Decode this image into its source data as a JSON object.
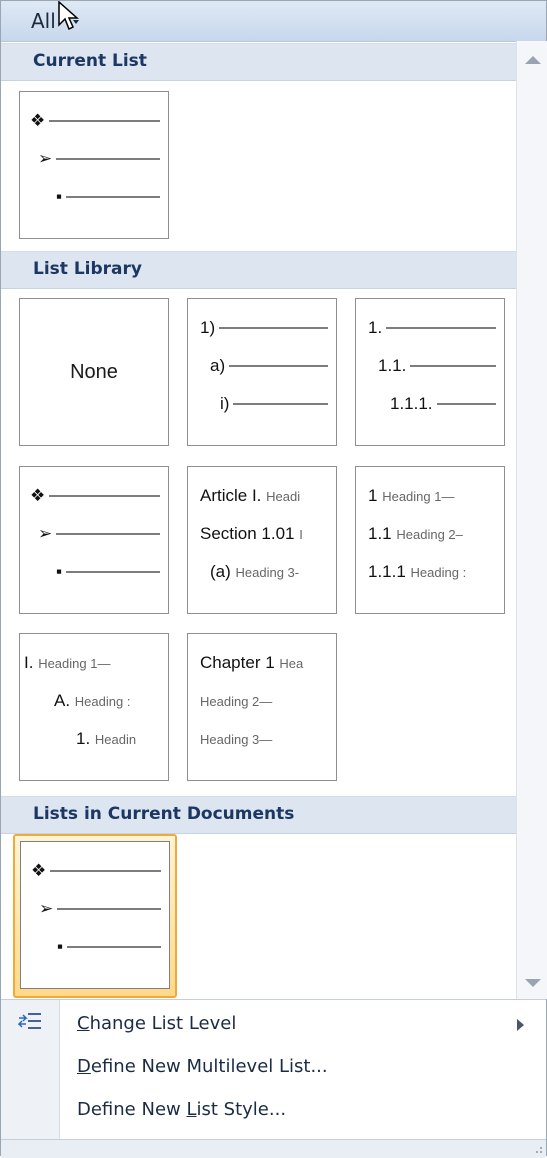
{
  "top_bar": {
    "label": "All"
  },
  "sections": {
    "current_list": "Current List",
    "list_library": "List Library",
    "lists_in_current_documents": "Lists in Current Documents"
  },
  "tiles": {
    "none_label": "None",
    "numbered_paren": [
      "1)",
      "a)",
      "i)"
    ],
    "numbered_decimal": [
      "1.",
      "1.1.",
      "1.1.1."
    ],
    "article_section": {
      "l1a": "Article I.",
      "l1b": "Headi",
      "l2a": "Section 1.01",
      "l2b": "I",
      "l3a": "(a)",
      "l3b": "Heading 3-"
    },
    "heading_decimal": {
      "l1a": "1",
      "l1b": "Heading 1—",
      "l2a": "1.1",
      "l2b": "Heading 2–",
      "l3a": "1.1.1",
      "l3b": "Heading :"
    },
    "roman_heading": {
      "l1a": "I.",
      "l1b": "Heading 1—",
      "l2a": "A.",
      "l2b": "Heading :",
      "l3a": "1.",
      "l3b": "Headin"
    },
    "chapter": {
      "l1a": "Chapter 1",
      "l1b": "Hea",
      "l2b": "Heading 2—",
      "l3b": "Heading 3—"
    }
  },
  "menu": {
    "change_list_level": {
      "pre": "",
      "u": "C",
      "post": "hange List Level"
    },
    "define_multilevel": {
      "pre": "",
      "u": "D",
      "post": "efine New Multilevel List..."
    },
    "define_list_style": {
      "pre": "Define New ",
      "u": "L",
      "post": "ist Style..."
    }
  },
  "icons": {
    "bullet_l1": "❖",
    "bullet_l2": "➢",
    "bullet_l3": "▪"
  },
  "colors": {
    "section_text": "#1b3762",
    "selected_border": "#f2a93b"
  }
}
